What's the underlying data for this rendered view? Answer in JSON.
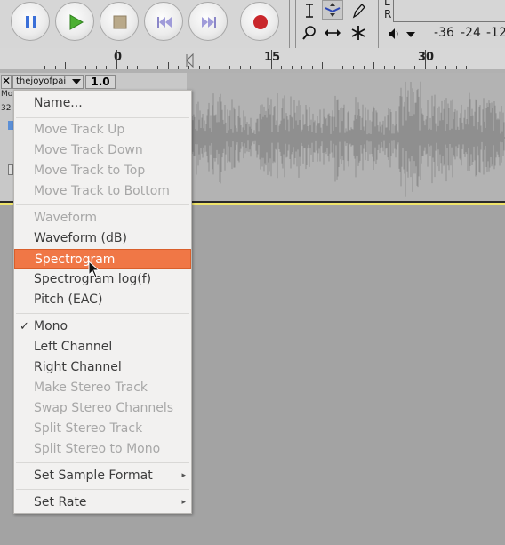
{
  "toolbar": {
    "meter_channels": [
      "L",
      "R"
    ],
    "meter_scale": [
      "-36",
      "-24",
      "-12"
    ]
  },
  "ruler": {
    "labels": [
      "0",
      "15",
      "30"
    ]
  },
  "track": {
    "name": "thejoyofpai",
    "gain_value": "1.0",
    "info_fragments": [
      "Mo",
      "32"
    ]
  },
  "menu": {
    "items": [
      {
        "label": "Name...",
        "enabled": true
      },
      {
        "label": "Move Track Up",
        "enabled": false
      },
      {
        "label": "Move Track Down",
        "enabled": false
      },
      {
        "label": "Move Track to Top",
        "enabled": false
      },
      {
        "label": "Move Track to Bottom",
        "enabled": false
      },
      {
        "label": "Waveform",
        "enabled": false
      },
      {
        "label": "Waveform (dB)",
        "enabled": true
      },
      {
        "label": "Spectrogram",
        "enabled": true,
        "highlighted": true
      },
      {
        "label": "Spectrogram log(f)",
        "enabled": true
      },
      {
        "label": "Pitch (EAC)",
        "enabled": true
      },
      {
        "label": "Mono",
        "enabled": true,
        "checked": true
      },
      {
        "label": "Left Channel",
        "enabled": true
      },
      {
        "label": "Right Channel",
        "enabled": true
      },
      {
        "label": "Make Stereo Track",
        "enabled": false
      },
      {
        "label": "Swap Stereo Channels",
        "enabled": false
      },
      {
        "label": "Split Stereo Track",
        "enabled": false
      },
      {
        "label": "Split Stereo to Mono",
        "enabled": false
      },
      {
        "label": "Set Sample Format",
        "enabled": true,
        "submenu": true
      },
      {
        "label": "Set Rate",
        "enabled": true,
        "submenu": true
      }
    ]
  },
  "colors": {
    "highlight": "#f07746",
    "waveform": "#8f8f8f",
    "track_border": "#f0e46a"
  }
}
